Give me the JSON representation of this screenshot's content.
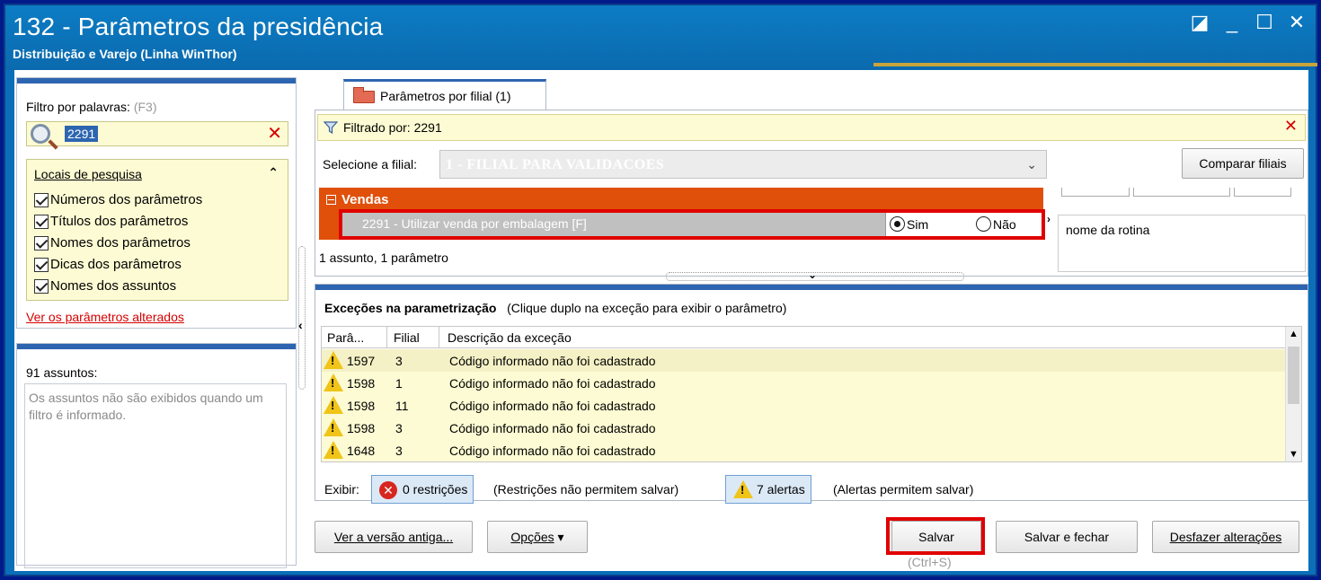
{
  "window": {
    "title": "132 - Parâmetros da presidência",
    "subtitle": "Distribuição e Varejo (Linha WinThor)"
  },
  "left": {
    "filter_label": "Filtro por palavras:",
    "filter_hint": "(F3)",
    "search_value": "2291",
    "locais_title": "Locais de pesquisa",
    "checkboxes": [
      {
        "label": "Números dos parâmetros",
        "checked": true
      },
      {
        "label": "Títulos dos parâmetros",
        "checked": true
      },
      {
        "label": "Nomes dos parâmetros",
        "checked": true
      },
      {
        "label": "Dicas dos parâmetros",
        "checked": true
      },
      {
        "label": "Nomes dos assuntos",
        "checked": true
      }
    ],
    "changed_link": "Ver os parâmetros alterados",
    "assuntos_count": "91 assuntos:",
    "assuntos_msg": "Os assuntos não são exibidos quando um filtro é informado."
  },
  "tab": {
    "label": "Parâmetros por filial",
    "count": "(1)"
  },
  "filter_bar": {
    "text": "Filtrado por: 2291"
  },
  "filial": {
    "label": "Selecione a filial:",
    "value": "1 - FILIAL PARA VALIDACOES",
    "compare_button": "Comparar filiais"
  },
  "group": {
    "name": "Vendas",
    "param_text": "2291 - Utilizar venda por embalagem [F]",
    "radio_yes": "Sim",
    "radio_no": "Não",
    "selected": "Sim"
  },
  "side_info": "nome da rotina",
  "result_count": "1 assunto, 1 parâmetro",
  "exceptions": {
    "title": "Exceções na parametrização",
    "hint": "(Clique duplo na exceção para exibir o parâmetro)",
    "columns": [
      "Parâ...",
      "Filial",
      "Descrição da exceção"
    ],
    "rows": [
      {
        "param": "1597",
        "filial": "3",
        "desc": "Código informado não foi cadastrado"
      },
      {
        "param": "1598",
        "filial": "1",
        "desc": "Código informado não foi cadastrado"
      },
      {
        "param": "1598",
        "filial": "11",
        "desc": "Código informado não foi cadastrado"
      },
      {
        "param": "1598",
        "filial": "3",
        "desc": "Código informado não foi cadastrado"
      },
      {
        "param": "1648",
        "filial": "3",
        "desc": "Código informado não foi cadastrado"
      }
    ],
    "exibir_label": "Exibir:",
    "restricoes": "0 restrições",
    "restricoes_note": "(Restrições não permitem salvar)",
    "alertas": "7 alertas",
    "alertas_note": "(Alertas permitem salvar)"
  },
  "buttons": {
    "old_version": "Ver a versão antiga...",
    "options": "Opções",
    "save": "Salvar",
    "save_shortcut": "(Ctrl+S)",
    "save_close": "Salvar e fechar",
    "undo": "Desfazer alterações"
  },
  "colors": {
    "title_bg": "#0a6fb8",
    "vendas_orange": "#e0500a",
    "highlight_yellow": "#fdfbd3",
    "annotation_red": "#e00000"
  }
}
